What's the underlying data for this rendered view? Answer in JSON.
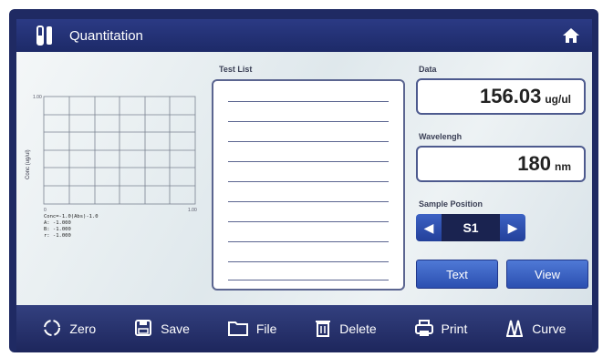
{
  "window": {
    "title": "Quantitation",
    "icons": {
      "app": "tubes-icon",
      "home": "home-icon"
    }
  },
  "chart": {
    "ylabel": "Conc (ug/ul)",
    "ytick_top": "1.00",
    "xtick_left": "0",
    "xtick_right": "1.00",
    "equation_lines": [
      "Conc=-1.0(Abs)-1.0",
      "A: -1.000",
      "B: -1.000",
      "r: -1.000"
    ]
  },
  "test_list": {
    "label": "Test List",
    "rows": 10
  },
  "data": {
    "label": "Data",
    "value": "156.03",
    "unit": "ug/ul"
  },
  "wavelength": {
    "label": "Wavelengh",
    "value": "180",
    "unit": "nm"
  },
  "sample_position": {
    "label": "Sample Position",
    "value": "S1"
  },
  "buttons": {
    "text": "Text",
    "view": "View"
  },
  "toolbar": [
    {
      "label": "Zero",
      "icon": "zero-icon"
    },
    {
      "label": "Save",
      "icon": "save-icon"
    },
    {
      "label": "File",
      "icon": "folder-icon"
    },
    {
      "label": "Delete",
      "icon": "trash-icon"
    },
    {
      "label": "Print",
      "icon": "printer-icon"
    },
    {
      "label": "Curve",
      "icon": "curve-icon"
    }
  ],
  "colors": {
    "accent": "#2b4fb0",
    "frame": "#1f2a63"
  }
}
